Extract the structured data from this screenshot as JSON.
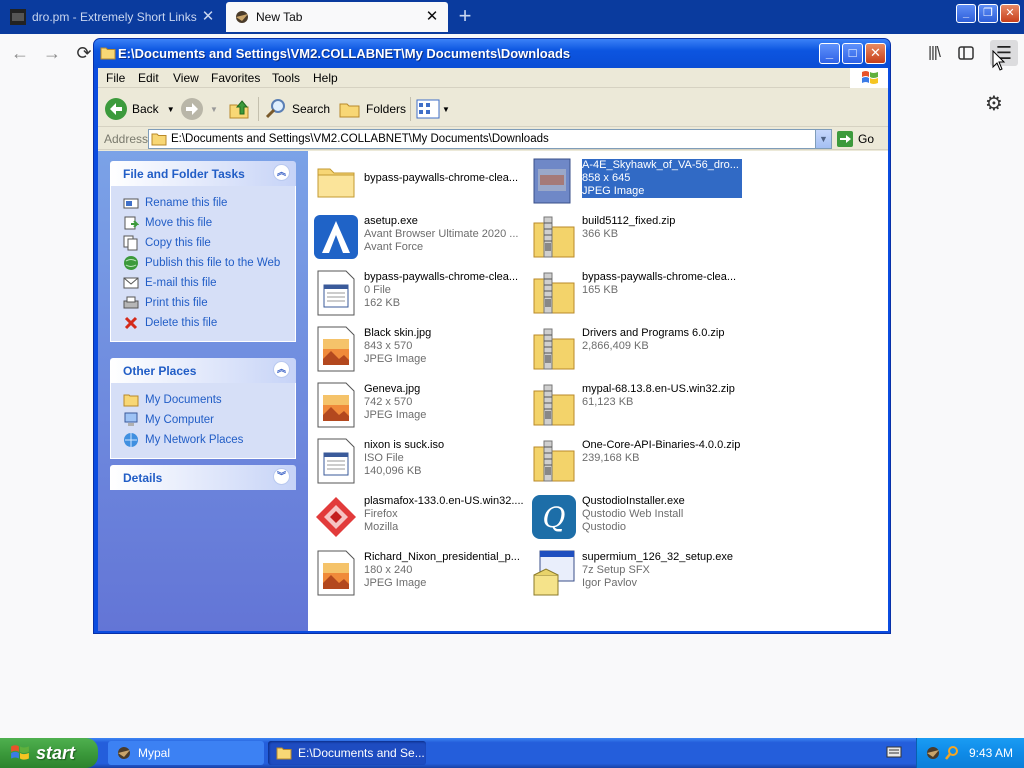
{
  "browser": {
    "tabs": [
      {
        "title": "dro.pm - Extremely Short Links",
        "close": "✕"
      },
      {
        "title": "New Tab",
        "close": "✕"
      }
    ],
    "new_tab": "+",
    "nav": {
      "back": "←",
      "forward": "→",
      "reload": "⟳",
      "library": "|||\\",
      "menu": "☰"
    },
    "window_controls": {
      "min": "_",
      "max": "❐",
      "close": "✕"
    },
    "gear": "⚙"
  },
  "explorer": {
    "title": "E:\\Documents and Settings\\VM2.COLLABNET\\My Documents\\Downloads",
    "controls": {
      "min": "_",
      "max": "□",
      "close": "✕"
    },
    "menu": [
      "File",
      "Edit",
      "View",
      "Favorites",
      "Tools",
      "Help"
    ],
    "toolbar": {
      "back": "Back",
      "search": "Search",
      "folders": "Folders"
    },
    "address": {
      "label": "Address",
      "value": "E:\\Documents and Settings\\VM2.COLLABNET\\My Documents\\Downloads",
      "go": "Go"
    },
    "taskpane": {
      "file_tasks": {
        "title": "File and Folder Tasks",
        "items": [
          "Rename this file",
          "Move this file",
          "Copy this file",
          "Publish this file to the Web",
          "E-mail this file",
          "Print this file",
          "Delete this file"
        ]
      },
      "other_places": {
        "title": "Other Places",
        "items": [
          "My Documents",
          "My Computer",
          "My Network Places"
        ]
      },
      "details": {
        "title": "Details"
      }
    },
    "files": [
      {
        "name": "bypass-paywalls-chrome-clea...",
        "l2": "",
        "l3": "",
        "icon": "folder"
      },
      {
        "name": "A-4E_Skyhawk_of_VA-56_dro...",
        "l2": "858 x 645",
        "l3": "JPEG Image",
        "icon": "jpeg-thumb",
        "selected": true
      },
      {
        "name": "asetup.exe",
        "l2": "Avant Browser Ultimate 2020 ...",
        "l3": "Avant Force",
        "icon": "avant"
      },
      {
        "name": "build5112_fixed.zip",
        "l2": "366 KB",
        "l3": "",
        "icon": "zip"
      },
      {
        "name": "bypass-paywalls-chrome-clea...",
        "l2": "0 File",
        "l3": "162 KB",
        "icon": "generic"
      },
      {
        "name": "bypass-paywalls-chrome-clea...",
        "l2": "165 KB",
        "l3": "",
        "icon": "zip"
      },
      {
        "name": "Black skin.jpg",
        "l2": "843 x 570",
        "l3": "JPEG Image",
        "icon": "image"
      },
      {
        "name": "Drivers and Programs 6.0.zip",
        "l2": "2,866,409 KB",
        "l3": "",
        "icon": "zip"
      },
      {
        "name": "Geneva.jpg",
        "l2": "742 x 570",
        "l3": "JPEG Image",
        "icon": "image"
      },
      {
        "name": "mypal-68.13.8.en-US.win32.zip",
        "l2": "61,123 KB",
        "l3": "",
        "icon": "zip"
      },
      {
        "name": "nixon is suck.iso",
        "l2": "ISO File",
        "l3": "140,096 KB",
        "icon": "generic"
      },
      {
        "name": "One-Core-API-Binaries-4.0.0.zip",
        "l2": "239,168 KB",
        "l3": "",
        "icon": "zip"
      },
      {
        "name": "plasmafox-133.0.en-US.win32....",
        "l2": "Firefox",
        "l3": "Mozilla",
        "icon": "plasmafox"
      },
      {
        "name": "QustodioInstaller.exe",
        "l2": "Qustodio Web Install",
        "l3": "Qustodio",
        "icon": "qustodio"
      },
      {
        "name": "Richard_Nixon_presidential_p...",
        "l2": "180 x 240",
        "l3": "JPEG Image",
        "icon": "image"
      },
      {
        "name": "supermium_126_32_setup.exe",
        "l2": "7z Setup SFX",
        "l3": "Igor Pavlov",
        "icon": "installer"
      }
    ]
  },
  "taskbar": {
    "start": "start",
    "tasks": [
      "Mypal",
      "E:\\Documents and Se..."
    ],
    "time": "9:43 AM"
  }
}
